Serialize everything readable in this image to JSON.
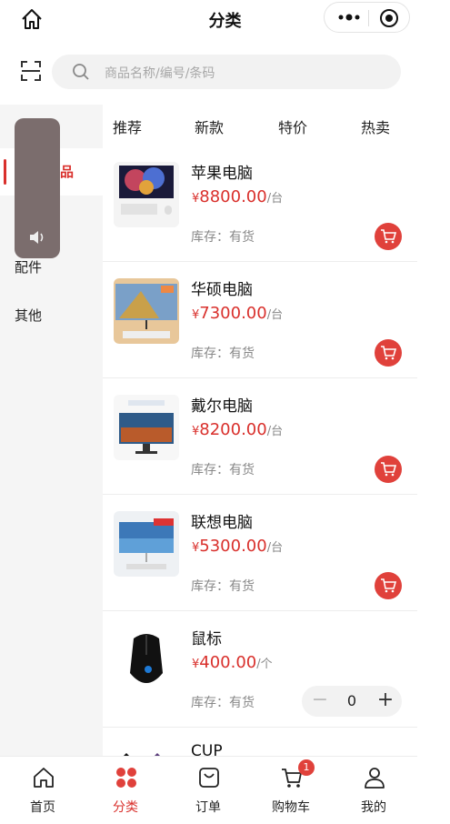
{
  "header": {
    "title": "分类",
    "home_icon": "home-icon",
    "more_icon": "more-dots-icon",
    "close_icon": "target-icon"
  },
  "search": {
    "placeholder": "商品名称/编号/条码",
    "scan_icon": "scan-icon"
  },
  "sidebar": {
    "items": [
      {
        "label": "品"
      },
      {
        "label": "配件"
      },
      {
        "label": "其他"
      }
    ]
  },
  "tabs": [
    "推荐",
    "新款",
    "特价",
    "热卖"
  ],
  "products": [
    {
      "name": "苹果电脑",
      "currency": "¥",
      "price": "8800.00",
      "unit": "/台",
      "stock": "库存：有货"
    },
    {
      "name": "华硕电脑",
      "currency": "¥",
      "price": "7300.00",
      "unit": "/台",
      "stock": "库存：有货"
    },
    {
      "name": "戴尔电脑",
      "currency": "¥",
      "price": "8200.00",
      "unit": "/台",
      "stock": "库存：有货"
    },
    {
      "name": "联想电脑",
      "currency": "¥",
      "price": "5300.00",
      "unit": "/台",
      "stock": "库存：有货"
    },
    {
      "name": "鼠标",
      "currency": "¥",
      "price": "400.00",
      "unit": "/个",
      "stock": "库存：有货",
      "qty": "0"
    },
    {
      "name": "CUP"
    }
  ],
  "bottom_nav": [
    {
      "label": "首页",
      "icon": "home-icon"
    },
    {
      "label": "分类",
      "icon": "category-icon"
    },
    {
      "label": "订单",
      "icon": "order-bag-icon"
    },
    {
      "label": "购物车",
      "icon": "cart-icon",
      "badge": "1"
    },
    {
      "label": "我的",
      "icon": "user-icon"
    }
  ],
  "colors": {
    "accent": "#d9302c",
    "cart_button": "#e0413b"
  }
}
